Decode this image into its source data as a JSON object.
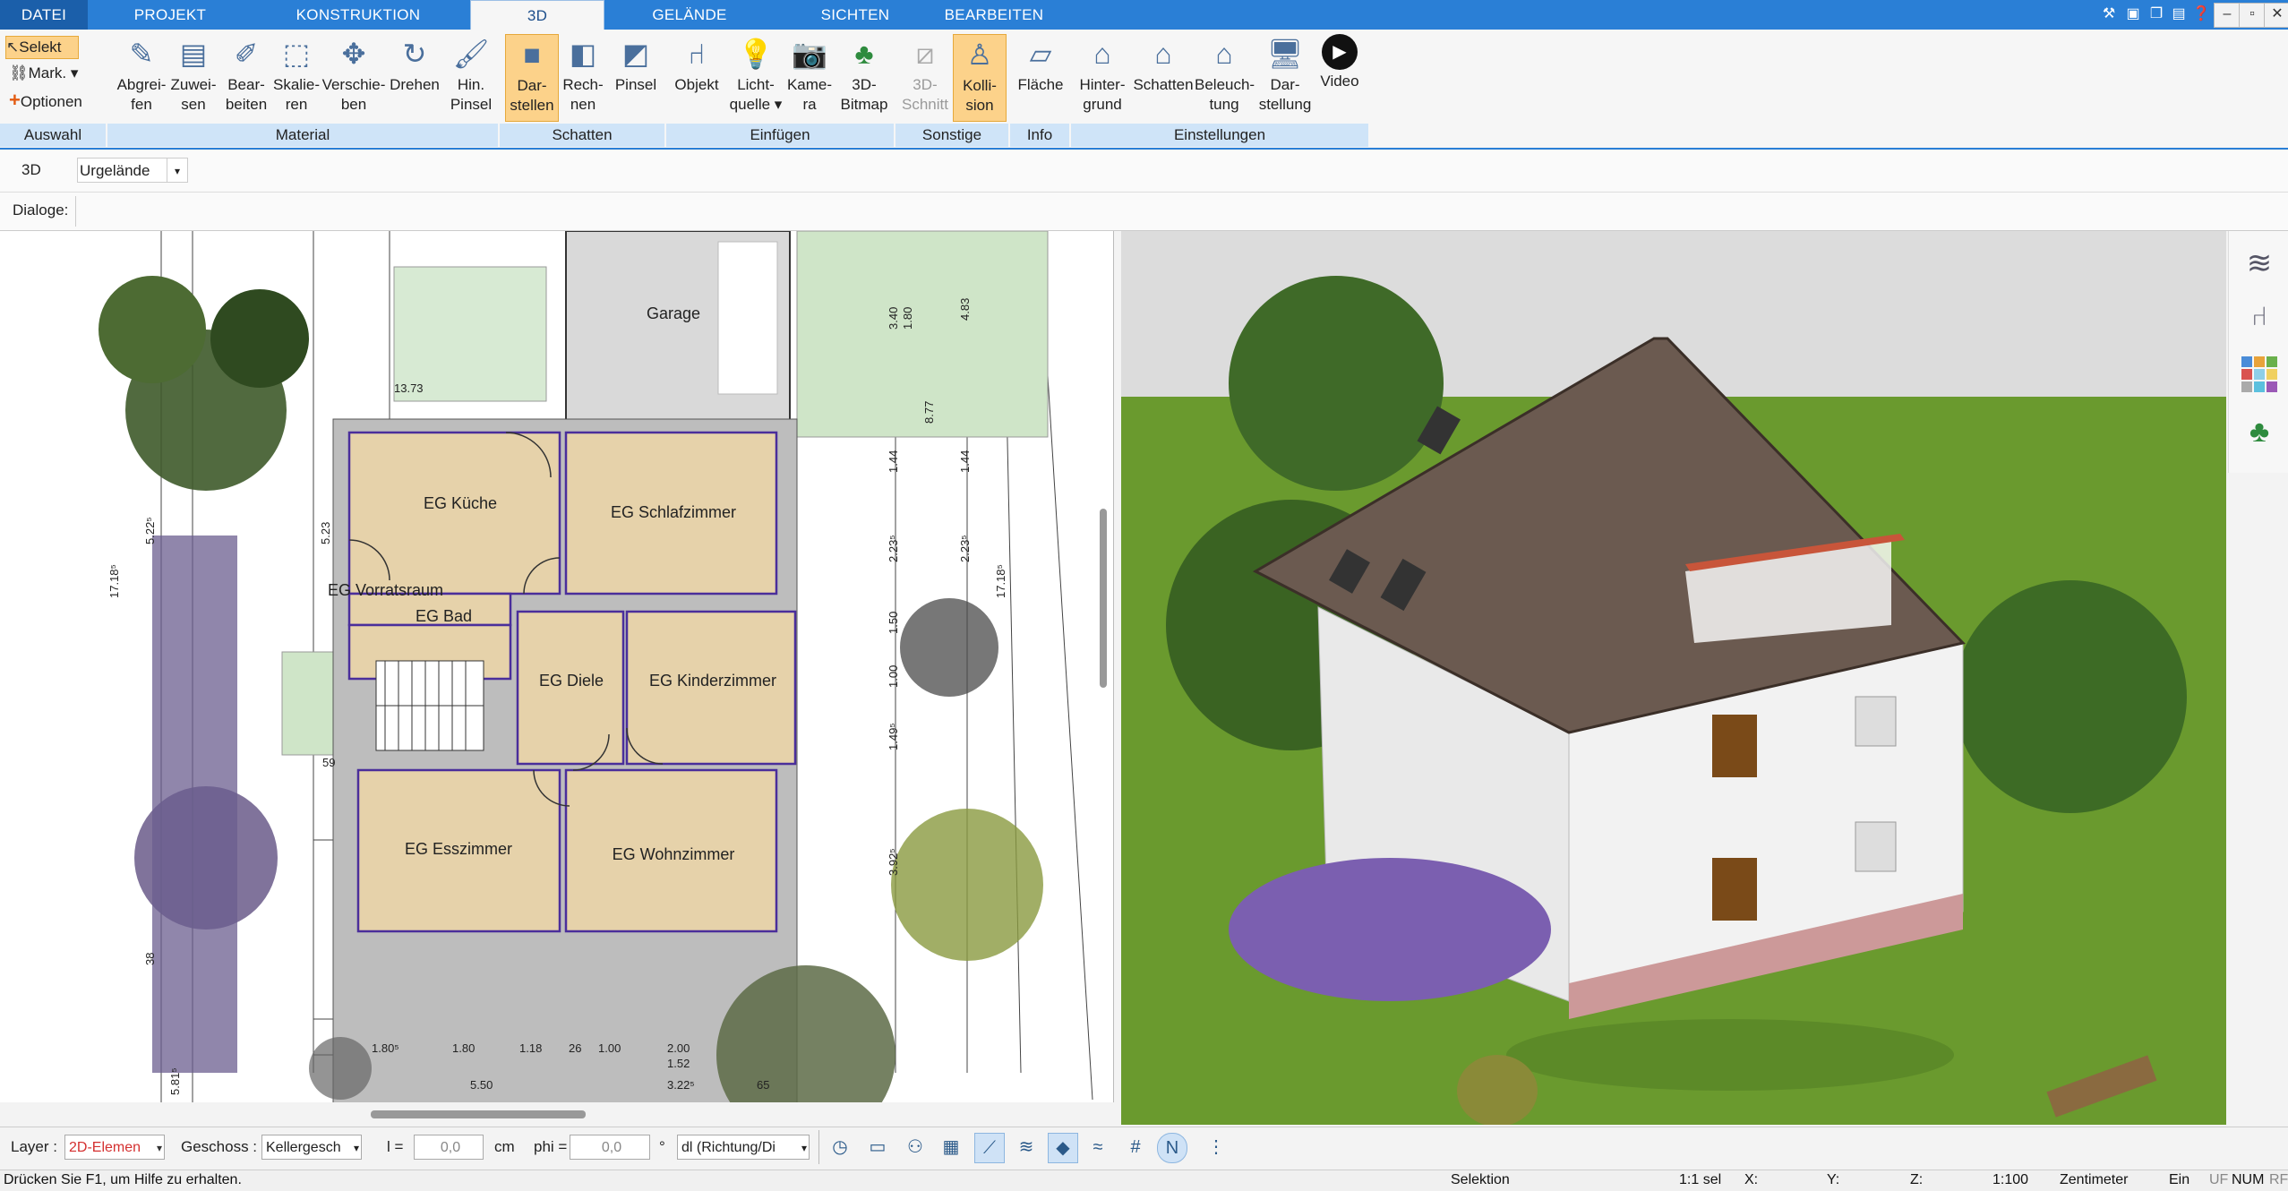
{
  "menu": {
    "tabs": [
      "DATEI",
      "PROJEKT",
      "KONSTRUKTION",
      "3D",
      "GELÄNDE",
      "SICHTEN",
      "BEARBEITEN"
    ],
    "active": "3D"
  },
  "ribbon": {
    "auswahl": {
      "select": "Selekt",
      "mark": "Mark.",
      "options": "Optionen",
      "group": "Auswahl"
    },
    "material": {
      "group": "Material",
      "buttons": [
        {
          "label": "Abgrei-\nfen",
          "icon": "eyedropper-icon"
        },
        {
          "label": "Zuwei-\nsen",
          "icon": "paint-assign-icon"
        },
        {
          "label": "Bear-\nbeiten",
          "icon": "edit-material-icon"
        },
        {
          "label": "Skalie-\nren",
          "icon": "scale-icon"
        },
        {
          "label": "Verschie-\nben",
          "icon": "move-icon"
        },
        {
          "label": "Drehen",
          "icon": "rotate-icon"
        },
        {
          "label": "Hin.\nPinsel",
          "icon": "brush-icon"
        }
      ]
    },
    "schatten": {
      "group": "Schatten",
      "buttons": [
        {
          "label": "Dar-\nstellen",
          "icon": "cube-shadow-icon",
          "selected": true
        },
        {
          "label": "Rech-\nnen",
          "icon": "cube-calc-icon"
        },
        {
          "label": "Pinsel",
          "icon": "cube-brush-icon"
        }
      ]
    },
    "einfuegen": {
      "group": "Einfügen",
      "buttons": [
        {
          "label": "Objekt",
          "icon": "chair-icon"
        },
        {
          "label": "Licht-\nquelle ▾",
          "icon": "lightbulb-icon"
        },
        {
          "label": "Kame-\nra",
          "icon": "camera-icon"
        },
        {
          "label": "3D-\nBitmap",
          "icon": "tree-icon"
        }
      ]
    },
    "sonstige": {
      "group": "Sonstige",
      "buttons": [
        {
          "label": "3D-\nSchnitt",
          "icon": "section-cut-icon",
          "disabled": true
        },
        {
          "label": "Kolli-\nsion",
          "icon": "collision-person-icon",
          "selected": true
        }
      ]
    },
    "info": {
      "group": "Info",
      "buttons": [
        {
          "label": "Fläche",
          "icon": "area-icon"
        }
      ]
    },
    "einstellungen": {
      "group": "Einstellungen",
      "buttons": [
        {
          "label": "Hinter-\ngrund",
          "icon": "background-house-icon"
        },
        {
          "label": "Schatten",
          "icon": "shadow-house-icon"
        },
        {
          "label": "Beleuch-\ntung",
          "icon": "lighting-house-icon"
        },
        {
          "label": "Dar-\nstellung",
          "icon": "display-monitor-icon"
        },
        {
          "label": "Video",
          "icon": "video-play-icon"
        }
      ]
    }
  },
  "row2": {
    "mode": "3D",
    "terrain": "Urgelände"
  },
  "row3": {
    "dialogs": "Dialoge:"
  },
  "plan": {
    "rooms": [
      "Garage",
      "EG Küche",
      "EG Schlafzimmer",
      "EG Vorratsraum",
      "EG Bad",
      "EG Diele",
      "EG Kinderzimmer",
      "EG Esszimmer",
      "EG Wohnzimmer"
    ],
    "dims_bottom": [
      "1.80⁵",
      "1.80",
      "1.18",
      "26",
      "1.00",
      "2.00",
      "1.52",
      "5.50",
      "3.22⁵",
      "65"
    ],
    "dims_right": [
      "3.40",
      "1.80",
      "4.83",
      "8.77",
      "1.44",
      "1.44",
      "2.23⁵",
      "2.23⁵",
      "1.50",
      "1.00",
      "1.49⁵",
      "17.18⁵",
      "3.92⁵"
    ],
    "dims_left": [
      "5.22⁵",
      "17.18⁵",
      "5.23",
      "38",
      "5.81⁵"
    ],
    "misc": [
      "13.73",
      "59"
    ]
  },
  "bottom": {
    "layer_label": "Layer :",
    "layer_value": "2D-Elemen",
    "floor_label": "Geschoss :",
    "floor_value": "Kellergesch",
    "l_label": "l =",
    "l_value": "0,0",
    "l_unit": "cm",
    "phi_label": "phi =",
    "phi_value": "0,0",
    "phi_unit": "°",
    "dl_value": "dl (Richtung/Di"
  },
  "status": {
    "help": "Drücken Sie F1, um Hilfe zu erhalten.",
    "mode": "Selektion",
    "sel": "1:1 sel",
    "x": "X:",
    "y": "Y:",
    "z": "Z:",
    "scale": "1:100",
    "unit": "Zentimeter",
    "ein": "Ein",
    "flags": [
      "UF",
      "NUM",
      "RF"
    ]
  },
  "colors": {
    "accent": "#2a7fd6",
    "grass": "#6a9a2e",
    "roof": "#6b5a50",
    "wall": "#e8e8e8",
    "floor": "#e6d2aa",
    "room_line": "#4a2e9b"
  }
}
